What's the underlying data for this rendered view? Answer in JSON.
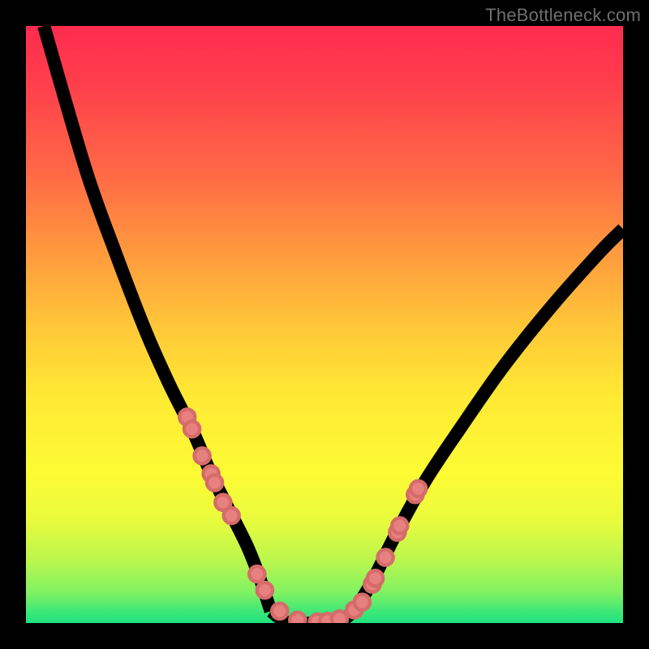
{
  "watermark": "TheBottleneck.com",
  "colors": {
    "frame": "#000000",
    "curve": "#000000",
    "dot_fill": "#e7817f",
    "dot_stroke": "#d56c6a",
    "gradient_top": "#ff2b4e",
    "gradient_bottom": "#1ee37f"
  },
  "chart_data": {
    "type": "line",
    "title": "",
    "xlabel": "",
    "ylabel": "",
    "xlim": [
      0,
      100
    ],
    "ylim": [
      0,
      100
    ],
    "note": "No axes or tick labels rendered. Values are approximate positions (0–100) for the V-shaped bottleneck curve and overlaid sample dots as visible in the image.",
    "series": [
      {
        "name": "left-branch",
        "x": [
          3,
          10,
          15,
          20,
          24,
          28,
          31,
          34,
          37,
          39,
          41
        ],
        "y": [
          100,
          76,
          62,
          49,
          40,
          32,
          25,
          19,
          13,
          8,
          2
        ]
      },
      {
        "name": "valley",
        "x": [
          41,
          44,
          48,
          52,
          55
        ],
        "y": [
          2,
          0,
          0,
          0,
          2
        ]
      },
      {
        "name": "right-branch",
        "x": [
          55,
          58,
          62,
          67,
          73,
          80,
          88,
          96,
          100
        ],
        "y": [
          2,
          7,
          15,
          24,
          33,
          43,
          53,
          62,
          66
        ]
      }
    ],
    "points": {
      "name": "sample-dots",
      "x": [
        27.0,
        27.8,
        29.5,
        31.0,
        31.6,
        33.0,
        34.4,
        38.7,
        40.0,
        42.5,
        45.5,
        48.8,
        50.5,
        52.5,
        55.0,
        56.3,
        58.0,
        58.5,
        60.2,
        62.2,
        62.6,
        65.2,
        65.7
      ],
      "y": [
        34.5,
        32.5,
        28.0,
        25.0,
        23.5,
        20.2,
        18.0,
        8.2,
        5.5,
        2.0,
        0.5,
        0.2,
        0.3,
        0.7,
        2.2,
        3.5,
        6.5,
        7.5,
        11.0,
        15.2,
        16.3,
        21.5,
        22.5
      ],
      "r": 1.3
    }
  }
}
